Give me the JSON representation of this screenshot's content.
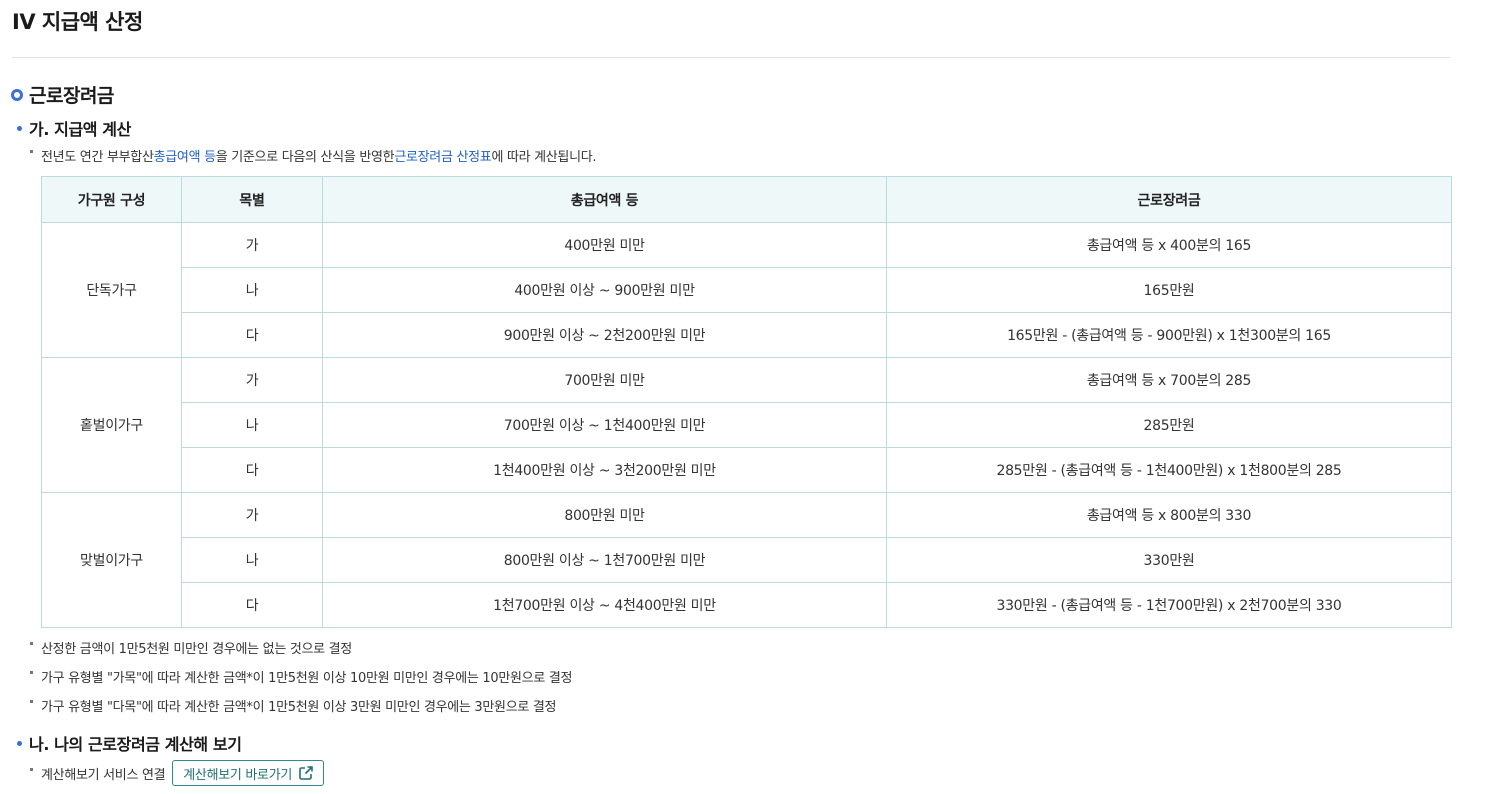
{
  "page": {
    "title": "IV 지급액 산정"
  },
  "section": {
    "title": "근로장려금"
  },
  "sub_a": {
    "title": "가. 지급액 계산",
    "desc_before": "전년도 연간 부부합산 ",
    "desc_link1": "총급여액 등",
    "desc_middle": "을 기준으로 다음의 산식을 반영한 ",
    "desc_link2": "근로장려금 산정표",
    "desc_after": "에 따라 계산됩니다."
  },
  "table": {
    "headers": [
      "가구원 구성",
      "목별",
      "총급여액 등",
      "근로장려금"
    ],
    "groups": [
      {
        "name": "단독가구",
        "rows": [
          {
            "grade": "가",
            "range": "400만원 미만",
            "amount": "총급여액 등 x 400분의 165"
          },
          {
            "grade": "나",
            "range": "400만원 이상 ~ 900만원 미만",
            "amount": "165만원"
          },
          {
            "grade": "다",
            "range": "900만원 이상 ~ 2천200만원 미만",
            "amount": "165만원 - (총급여액 등 - 900만원) x 1천300분의 165"
          }
        ]
      },
      {
        "name": "홑벌이가구",
        "rows": [
          {
            "grade": "가",
            "range": "700만원 미만",
            "amount": "총급여액 등 x 700분의 285"
          },
          {
            "grade": "나",
            "range": "700만원 이상 ~ 1천400만원 미만",
            "amount": "285만원"
          },
          {
            "grade": "다",
            "range": "1천400만원 이상 ~ 3천200만원 미만",
            "amount": "285만원 - (총급여액 등 - 1천400만원) x 1천800분의 285"
          }
        ]
      },
      {
        "name": "맞벌이가구",
        "rows": [
          {
            "grade": "가",
            "range": "800만원 미만",
            "amount": "총급여액 등 x 800분의 330"
          },
          {
            "grade": "나",
            "range": "800만원 이상 ~ 1천700만원 미만",
            "amount": "330만원"
          },
          {
            "grade": "다",
            "range": "1천700만원 이상 ~ 4천400만원 미만",
            "amount": "330만원 - (총급여액 등 - 1천700만원) x 2천700분의 330"
          }
        ]
      }
    ]
  },
  "notes": [
    "산정한 금액이 1만5천원 미만인 경우에는 없는 것으로 결정",
    "가구 유형별 \"가목\"에 따라 계산한 금액*이 1만5천원 이상 10만원 미만인 경우에는 10만원으로 결정",
    "가구 유형별 \"다목\"에 따라 계산한 금액*이 1만5천원 이상 3만원 미만인 경우에는 3만원으로 결정"
  ],
  "sub_b": {
    "title": "나. 나의 근로장려금 계산해 보기",
    "service_label": "계산해보기 서비스 연결",
    "button_label": "계산해보기 바로가기"
  },
  "icons": {
    "section": "ring-icon",
    "bullet": "dot-icon",
    "link": "external-link-icon"
  },
  "colors": {
    "accent": "#3a6fd8",
    "link": "#1f5fc4",
    "table_header_bg": "#eef8f8",
    "table_border": "#bcd9dc",
    "button_border": "#2c8a90"
  }
}
